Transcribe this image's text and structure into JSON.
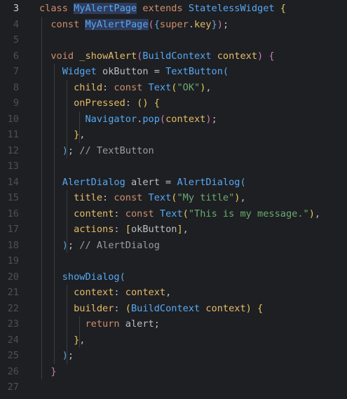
{
  "editor": {
    "active_line": "3",
    "lines": [
      {
        "n": "3",
        "tokens": [
          {
            "t": "class ",
            "c": "kw"
          },
          {
            "t": "MyAlertPage",
            "c": "ty hl"
          },
          {
            "t": " ",
            "c": "pun"
          },
          {
            "t": "extends",
            "c": "kw"
          },
          {
            "t": " ",
            "c": "pun"
          },
          {
            "t": "StatelessWidget",
            "c": "ty"
          },
          {
            "t": " {",
            "c": "br1"
          }
        ]
      },
      {
        "n": "4",
        "tokens": [
          {
            "t": "  const ",
            "c": "kw"
          },
          {
            "t": "MyAlertPage",
            "c": "ty hl"
          },
          {
            "t": "(",
            "c": "br2"
          },
          {
            "t": "{",
            "c": "br3"
          },
          {
            "t": "super",
            "c": "kw"
          },
          {
            "t": ".",
            "c": "pun"
          },
          {
            "t": "key",
            "c": "pr"
          },
          {
            "t": "}",
            "c": "br3"
          },
          {
            "t": ")",
            "c": "br2"
          },
          {
            "t": ";",
            "c": "pun"
          }
        ]
      },
      {
        "n": "5",
        "tokens": []
      },
      {
        "n": "6",
        "tokens": [
          {
            "t": "  void ",
            "c": "kw"
          },
          {
            "t": "_showAlert",
            "c": "pr"
          },
          {
            "t": "(",
            "c": "br2"
          },
          {
            "t": "BuildContext",
            "c": "ty"
          },
          {
            "t": " context",
            "c": "pr"
          },
          {
            "t": ")",
            "c": "br2"
          },
          {
            "t": " {",
            "c": "br2"
          }
        ]
      },
      {
        "n": "7",
        "tokens": [
          {
            "t": "    Widget ",
            "c": "ty"
          },
          {
            "t": "okButton",
            "c": "id"
          },
          {
            "t": " = ",
            "c": "pun"
          },
          {
            "t": "TextButton",
            "c": "ty"
          },
          {
            "t": "(",
            "c": "br3"
          }
        ]
      },
      {
        "n": "8",
        "tokens": [
          {
            "t": "      child",
            "c": "lbl"
          },
          {
            "t": ": ",
            "c": "pun"
          },
          {
            "t": "const ",
            "c": "kw"
          },
          {
            "t": "Text",
            "c": "ty"
          },
          {
            "t": "(",
            "c": "br1"
          },
          {
            "t": "\"OK\"",
            "c": "st"
          },
          {
            "t": ")",
            "c": "br1"
          },
          {
            "t": ",",
            "c": "pun"
          }
        ]
      },
      {
        "n": "9",
        "tokens": [
          {
            "t": "      onPressed",
            "c": "lbl"
          },
          {
            "t": ": ",
            "c": "pun"
          },
          {
            "t": "()",
            "c": "br1"
          },
          {
            "t": " {",
            "c": "br1"
          }
        ]
      },
      {
        "n": "10",
        "tokens": [
          {
            "t": "        Navigator",
            "c": "ty"
          },
          {
            "t": ".",
            "c": "pun"
          },
          {
            "t": "pop",
            "c": "fn"
          },
          {
            "t": "(",
            "c": "br2"
          },
          {
            "t": "context",
            "c": "pr"
          },
          {
            "t": ")",
            "c": "br2"
          },
          {
            "t": ";",
            "c": "pun"
          }
        ]
      },
      {
        "n": "11",
        "tokens": [
          {
            "t": "      }",
            "c": "br1"
          },
          {
            "t": ",",
            "c": "pun"
          }
        ]
      },
      {
        "n": "12",
        "tokens": [
          {
            "t": "    )",
            "c": "br3"
          },
          {
            "t": "; ",
            "c": "pun"
          },
          {
            "t": "// TextButton",
            "c": "cm"
          }
        ]
      },
      {
        "n": "13",
        "tokens": []
      },
      {
        "n": "14",
        "tokens": [
          {
            "t": "    AlertDialog ",
            "c": "ty"
          },
          {
            "t": "alert",
            "c": "id"
          },
          {
            "t": " = ",
            "c": "pun"
          },
          {
            "t": "AlertDialog",
            "c": "ty"
          },
          {
            "t": "(",
            "c": "br3"
          }
        ]
      },
      {
        "n": "15",
        "tokens": [
          {
            "t": "      title",
            "c": "lbl"
          },
          {
            "t": ": ",
            "c": "pun"
          },
          {
            "t": "const ",
            "c": "kw"
          },
          {
            "t": "Text",
            "c": "ty"
          },
          {
            "t": "(",
            "c": "br1"
          },
          {
            "t": "\"My title\"",
            "c": "st"
          },
          {
            "t": ")",
            "c": "br1"
          },
          {
            "t": ",",
            "c": "pun"
          }
        ]
      },
      {
        "n": "16",
        "tokens": [
          {
            "t": "      content",
            "c": "lbl"
          },
          {
            "t": ": ",
            "c": "pun"
          },
          {
            "t": "const ",
            "c": "kw"
          },
          {
            "t": "Text",
            "c": "ty"
          },
          {
            "t": "(",
            "c": "br1"
          },
          {
            "t": "\"This is my message.\"",
            "c": "st"
          },
          {
            "t": ")",
            "c": "br1"
          },
          {
            "t": ",",
            "c": "pun"
          }
        ]
      },
      {
        "n": "17",
        "tokens": [
          {
            "t": "      actions",
            "c": "lbl"
          },
          {
            "t": ": ",
            "c": "pun"
          },
          {
            "t": "[",
            "c": "br1"
          },
          {
            "t": "okButton",
            "c": "id"
          },
          {
            "t": "]",
            "c": "br1"
          },
          {
            "t": ",",
            "c": "pun"
          }
        ]
      },
      {
        "n": "18",
        "tokens": [
          {
            "t": "    )",
            "c": "br3"
          },
          {
            "t": "; ",
            "c": "pun"
          },
          {
            "t": "// AlertDialog",
            "c": "cm"
          }
        ]
      },
      {
        "n": "19",
        "tokens": []
      },
      {
        "n": "20",
        "tokens": [
          {
            "t": "    showDialog",
            "c": "fn"
          },
          {
            "t": "(",
            "c": "br3"
          }
        ]
      },
      {
        "n": "21",
        "tokens": [
          {
            "t": "      context",
            "c": "lbl"
          },
          {
            "t": ": ",
            "c": "pun"
          },
          {
            "t": "context",
            "c": "pr"
          },
          {
            "t": ",",
            "c": "pun"
          }
        ]
      },
      {
        "n": "22",
        "tokens": [
          {
            "t": "      builder",
            "c": "lbl"
          },
          {
            "t": ": ",
            "c": "pun"
          },
          {
            "t": "(",
            "c": "br1"
          },
          {
            "t": "BuildContext",
            "c": "ty"
          },
          {
            "t": " context",
            "c": "pr"
          },
          {
            "t": ")",
            "c": "br1"
          },
          {
            "t": " {",
            "c": "br1"
          }
        ]
      },
      {
        "n": "23",
        "tokens": [
          {
            "t": "        return ",
            "c": "kw"
          },
          {
            "t": "alert",
            "c": "id"
          },
          {
            "t": ";",
            "c": "pun"
          }
        ]
      },
      {
        "n": "24",
        "tokens": [
          {
            "t": "      }",
            "c": "br1"
          },
          {
            "t": ",",
            "c": "pun"
          }
        ]
      },
      {
        "n": "25",
        "tokens": [
          {
            "t": "    )",
            "c": "br3"
          },
          {
            "t": ";",
            "c": "pun"
          }
        ]
      },
      {
        "n": "26",
        "tokens": [
          {
            "t": "  }",
            "c": "br2"
          }
        ]
      },
      {
        "n": "27",
        "tokens": []
      }
    ]
  },
  "colors": {
    "background": "#1e1f22",
    "keyword": "#cf8e6d",
    "type": "#56a8f5",
    "string": "#6aab73",
    "comment": "#9a9da3"
  }
}
